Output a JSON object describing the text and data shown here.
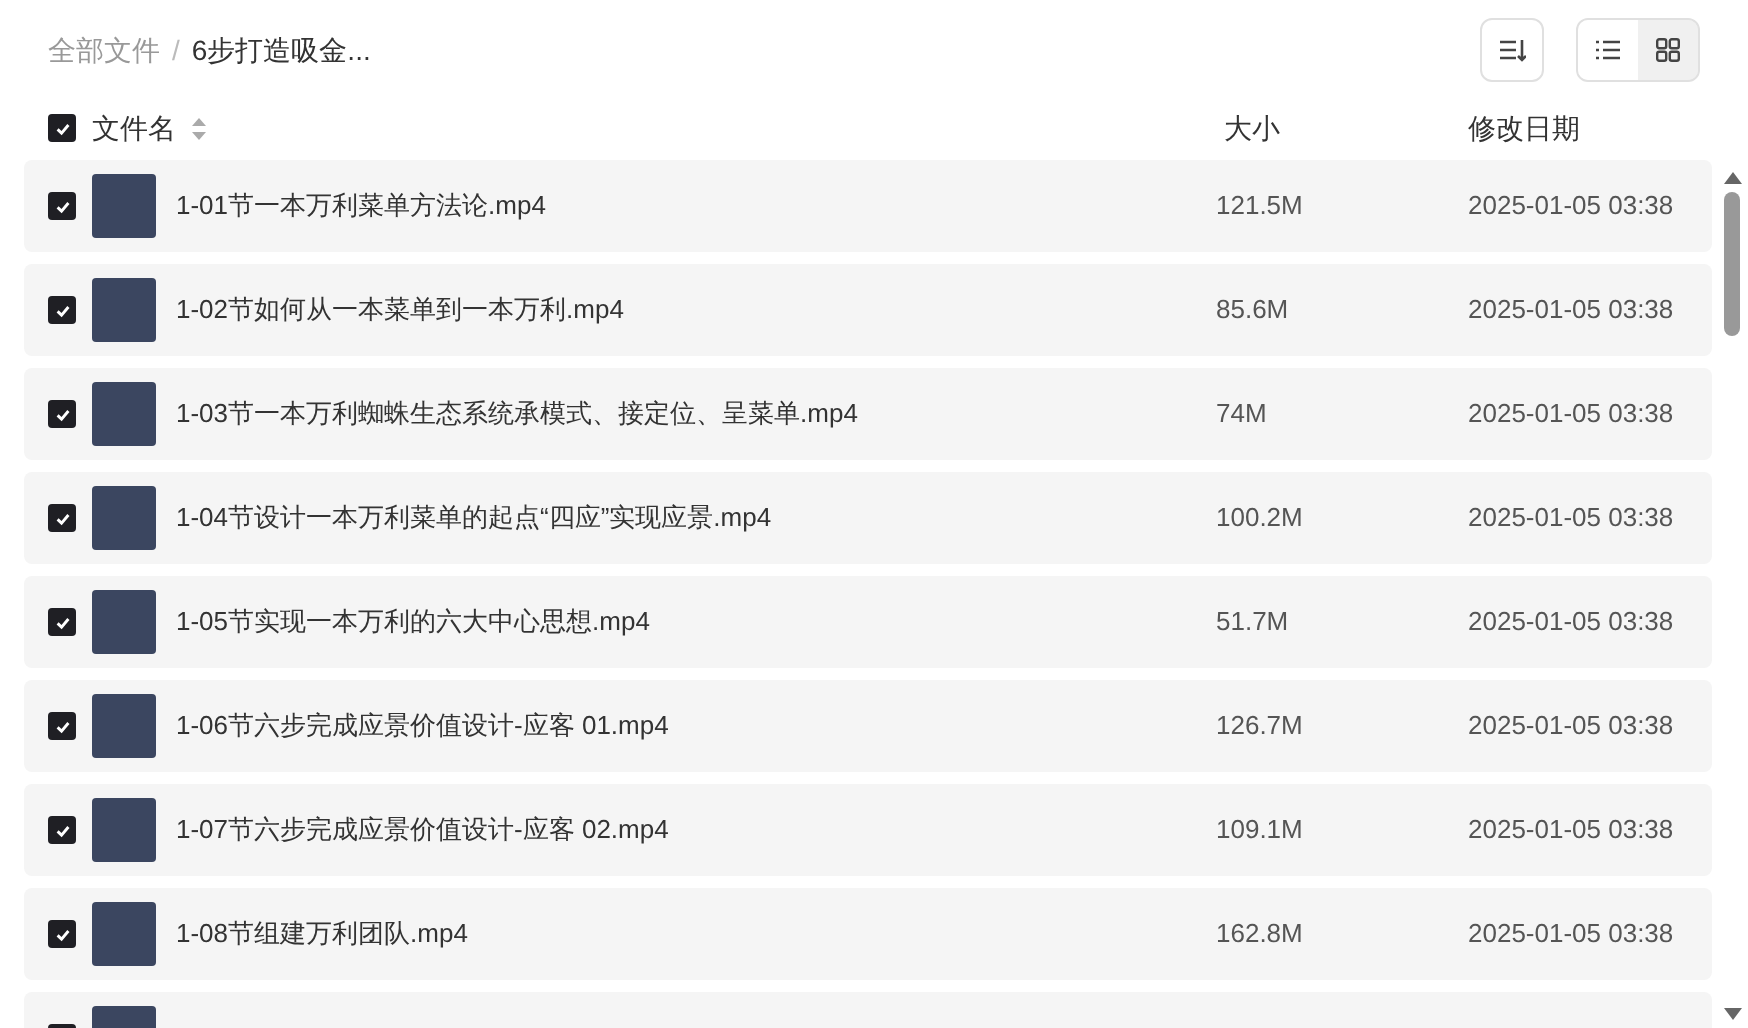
{
  "breadcrumb": [
    {
      "label": "全部文件",
      "current": false
    },
    {
      "label": "6步打造吸金...",
      "current": true
    }
  ],
  "breadcrumb_separator": "/",
  "view_toggle": [
    {
      "kind": "list",
      "selected": true
    },
    {
      "kind": "grid",
      "selected": false
    }
  ],
  "header": {
    "checked": true,
    "name": "文件名",
    "size": "大小",
    "date": "修改日期"
  },
  "rows": [
    {
      "checked": true,
      "name": "1-01节一本万利菜单方法论.mp4",
      "size": "121.5M",
      "date": "2025-01-05 03:38"
    },
    {
      "checked": true,
      "name": "1-02节如何从一本菜单到一本万利.mp4",
      "size": "85.6M",
      "date": "2025-01-05 03:38"
    },
    {
      "checked": true,
      "name": "1-03节一本万利蜘蛛生态系统承模式、接定位、呈菜单.mp4",
      "size": "74M",
      "date": "2025-01-05 03:38"
    },
    {
      "checked": true,
      "name": "1-04节设计一本万利菜单的起点“四应”实现应景.mp4",
      "size": "100.2M",
      "date": "2025-01-05 03:38"
    },
    {
      "checked": true,
      "name": "1-05节实现一本万利的六大中心思想.mp4",
      "size": "51.7M",
      "date": "2025-01-05 03:38"
    },
    {
      "checked": true,
      "name": "1-06节六步完成应景价值设计-应客 01.mp4",
      "size": "126.7M",
      "date": "2025-01-05 03:38"
    },
    {
      "checked": true,
      "name": "1-07节六步完成应景价值设计-应客 02.mp4",
      "size": "109.1M",
      "date": "2025-01-05 03:38"
    },
    {
      "checked": true,
      "name": "1-08节组建万利团队.mp4",
      "size": "162.8M",
      "date": "2025-01-05 03:38"
    },
    {
      "checked": true
    }
  ]
}
